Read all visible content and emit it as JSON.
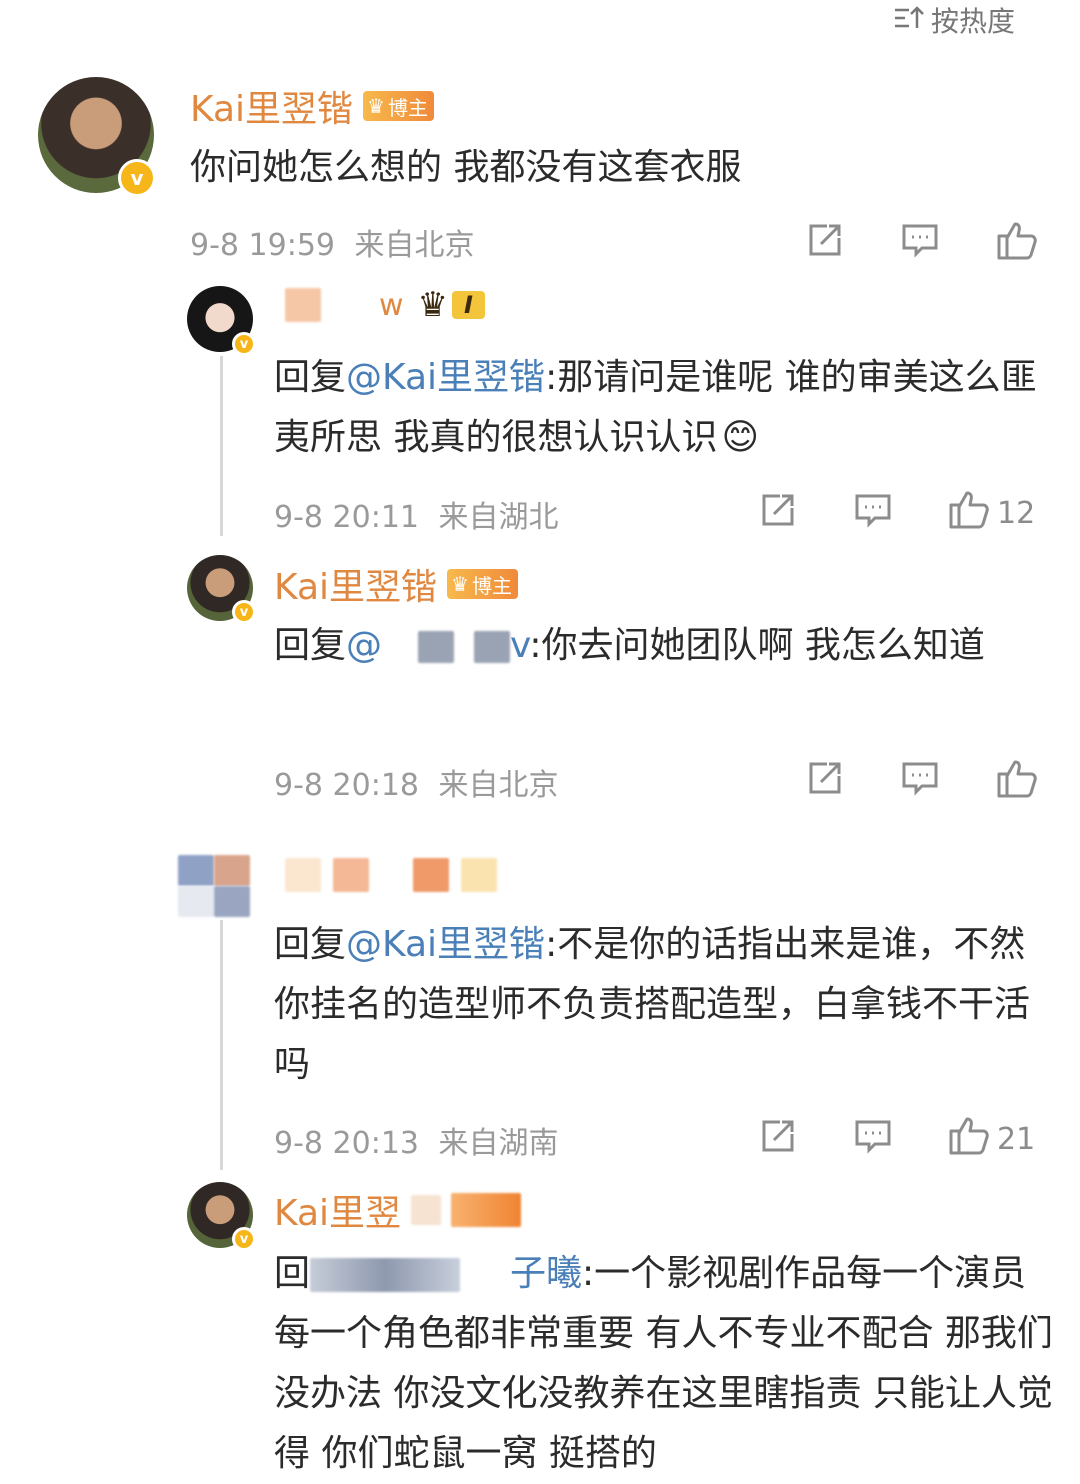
{
  "sort_label": "按热度",
  "main_comment": {
    "username": "Kai里翌锴",
    "badge": "博主",
    "text": "你问她怎么想的 我都没有这套衣服",
    "time": "9-8 19:59",
    "location": "来自北京"
  },
  "replies": [
    {
      "username_visible": "w",
      "level_badge": "I",
      "mention": "@Kai里翌锴",
      "prefix": "回复",
      "text": ":那请问是谁呢 谁的审美这么匪夷所思 我真的很想认识认识",
      "emoji": "😊",
      "time": "9-8 20:11",
      "location": "来自湖北",
      "likes": "12"
    },
    {
      "username": "Kai里翌锴",
      "badge": "博主",
      "prefix": "回复",
      "mention": "@",
      "mention_tail": "v",
      "text": ":你去问她团队啊 我怎么知道",
      "time": "9-8 20:18",
      "location": "来自北京"
    },
    {
      "prefix": "回复",
      "mention": "@Kai里翌锴",
      "text": ":不是你的话指出来是谁，不然你挂名的造型师不负责搭配造型，白拿钱不干活吗",
      "time": "9-8 20:13",
      "location": "来自湖南",
      "likes": "21"
    },
    {
      "username": "Kai里翌",
      "prefix": "回",
      "mention_tail": "子曦",
      "text": ":一个影视剧作品每一个演员 每一个角色都非常重要 有人不专业不配合 那我们没办法 你没文化没教养在这里瞎指责 只能让人觉得 你们蛇鼠一窝 挺搭的"
    }
  ],
  "icons": [
    "sort-icon",
    "share-icon",
    "comment-icon",
    "like-icon",
    "verified-icon",
    "crown-icon"
  ],
  "colors": {
    "name": "#e08740",
    "mention": "#4a7fb8",
    "meta": "#9a9a9a",
    "verified": "#f6b619"
  }
}
